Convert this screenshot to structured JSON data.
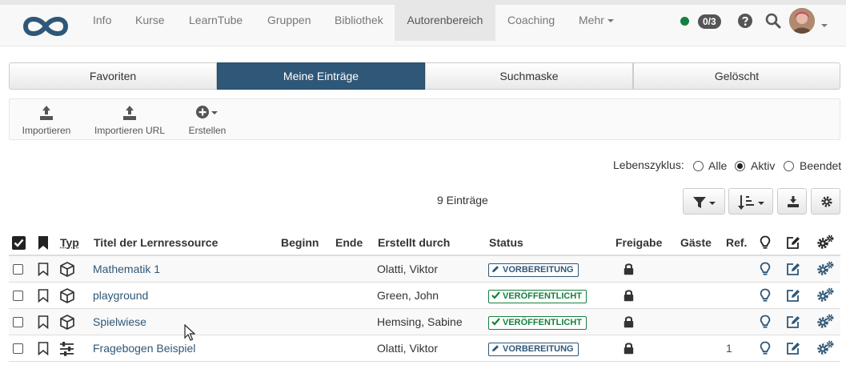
{
  "nav": {
    "items": [
      {
        "label": "Info"
      },
      {
        "label": "Kurse"
      },
      {
        "label": "LearnTube"
      },
      {
        "label": "Gruppen"
      },
      {
        "label": "Bibliothek"
      },
      {
        "label": "Autorenbereich"
      },
      {
        "label": "Coaching"
      },
      {
        "label": "Mehr"
      }
    ],
    "active_item": "Autorenbereich",
    "counter": "0/3",
    "status_color": "#15803d",
    "icons": [
      "help-icon",
      "search-icon",
      "avatar",
      "chevron-down-icon"
    ]
  },
  "tabs": [
    {
      "label": "Favoriten"
    },
    {
      "label": "Meine Einträge"
    },
    {
      "label": "Suchmaske"
    },
    {
      "label": "Gelöscht"
    }
  ],
  "active_tab": "Meine Einträge",
  "toolbar": {
    "import_label": "Importieren",
    "import_url_label": "Importieren URL",
    "create_label": "Erstellen"
  },
  "lifecycle": {
    "label": "Lebenszyklus:",
    "options": [
      "Alle",
      "Aktiv",
      "Beendet"
    ],
    "selected": "Aktiv"
  },
  "entries_count": "9 Einträge",
  "table": {
    "headers": {
      "type": "Typ",
      "title": "Titel der Lernressource",
      "begin": "Beginn",
      "end": "Ende",
      "author": "Erstellt durch",
      "status": "Status",
      "share": "Freigabe",
      "guests": "Gäste",
      "ref": "Ref."
    },
    "rows": [
      {
        "type_icon": "cube-icon",
        "title": "Mathematik 1",
        "author": "Olatti, Viktor",
        "status": "VORBEREITUNG",
        "status_kind": "prep",
        "ref": ""
      },
      {
        "type_icon": "cube-icon",
        "title": "playground",
        "author": "Green, John",
        "status": "VERÖFFENTLICHT",
        "status_kind": "pub",
        "ref": ""
      },
      {
        "type_icon": "cube-icon",
        "title": "Spielwiese",
        "author": "Hemsing, Sabine",
        "status": "VERÖFFENTLICHT",
        "status_kind": "pub",
        "ref": ""
      },
      {
        "type_icon": "sliders-icon",
        "title": "Fragebogen Beispiel",
        "author": "Olatti, Viktor",
        "status": "VORBEREITUNG",
        "status_kind": "prep",
        "ref": "1"
      }
    ]
  },
  "colors": {
    "brand": "#2f5777",
    "published": "#15803d"
  }
}
